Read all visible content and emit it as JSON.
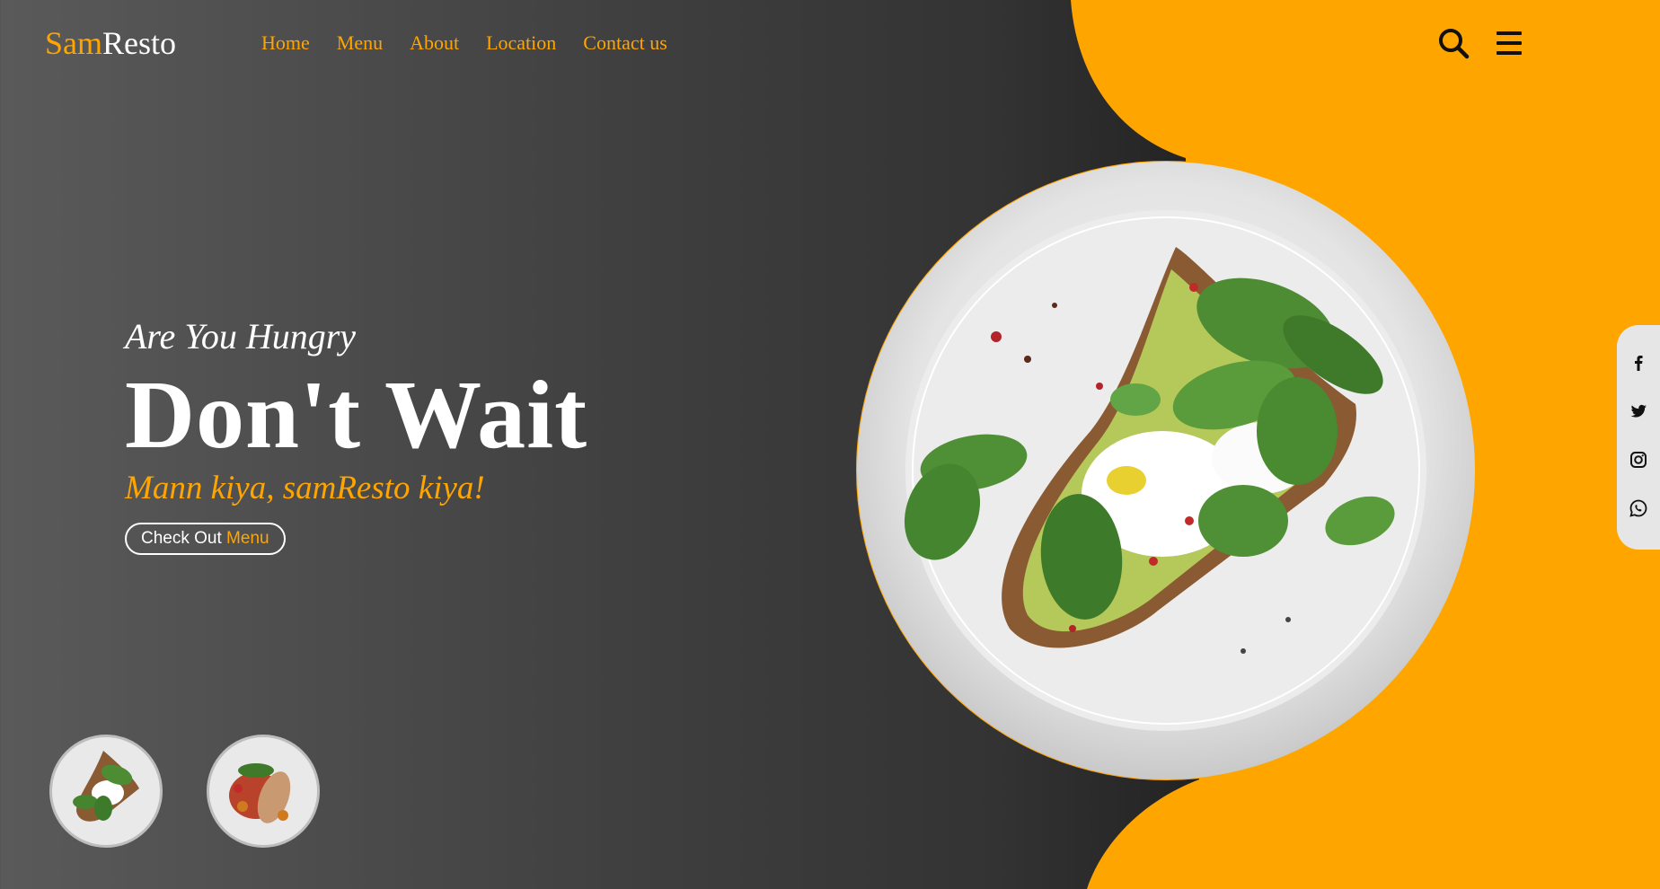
{
  "brand": {
    "part1": "Sam",
    "part2": "Resto"
  },
  "nav": {
    "items": [
      {
        "label": "Home"
      },
      {
        "label": "Menu"
      },
      {
        "label": "About"
      },
      {
        "label": "Location"
      },
      {
        "label": "Contact us"
      }
    ]
  },
  "header_icons": [
    "search-icon",
    "hamburger-menu-icon"
  ],
  "hero": {
    "tagline": "Are You Hungry",
    "headline": "Don't Wait",
    "slogan": "Mann kiya, samResto kiya!",
    "cta": {
      "part1": "Check Out ",
      "part2": "Menu"
    }
  },
  "social": [
    "facebook-icon",
    "twitter-icon",
    "instagram-icon",
    "whatsapp-icon"
  ],
  "colors": {
    "accent": "#ffa500",
    "background_dark": "#1f1f1f",
    "background_light": "#5a5a5a",
    "text": "#ffffff"
  }
}
